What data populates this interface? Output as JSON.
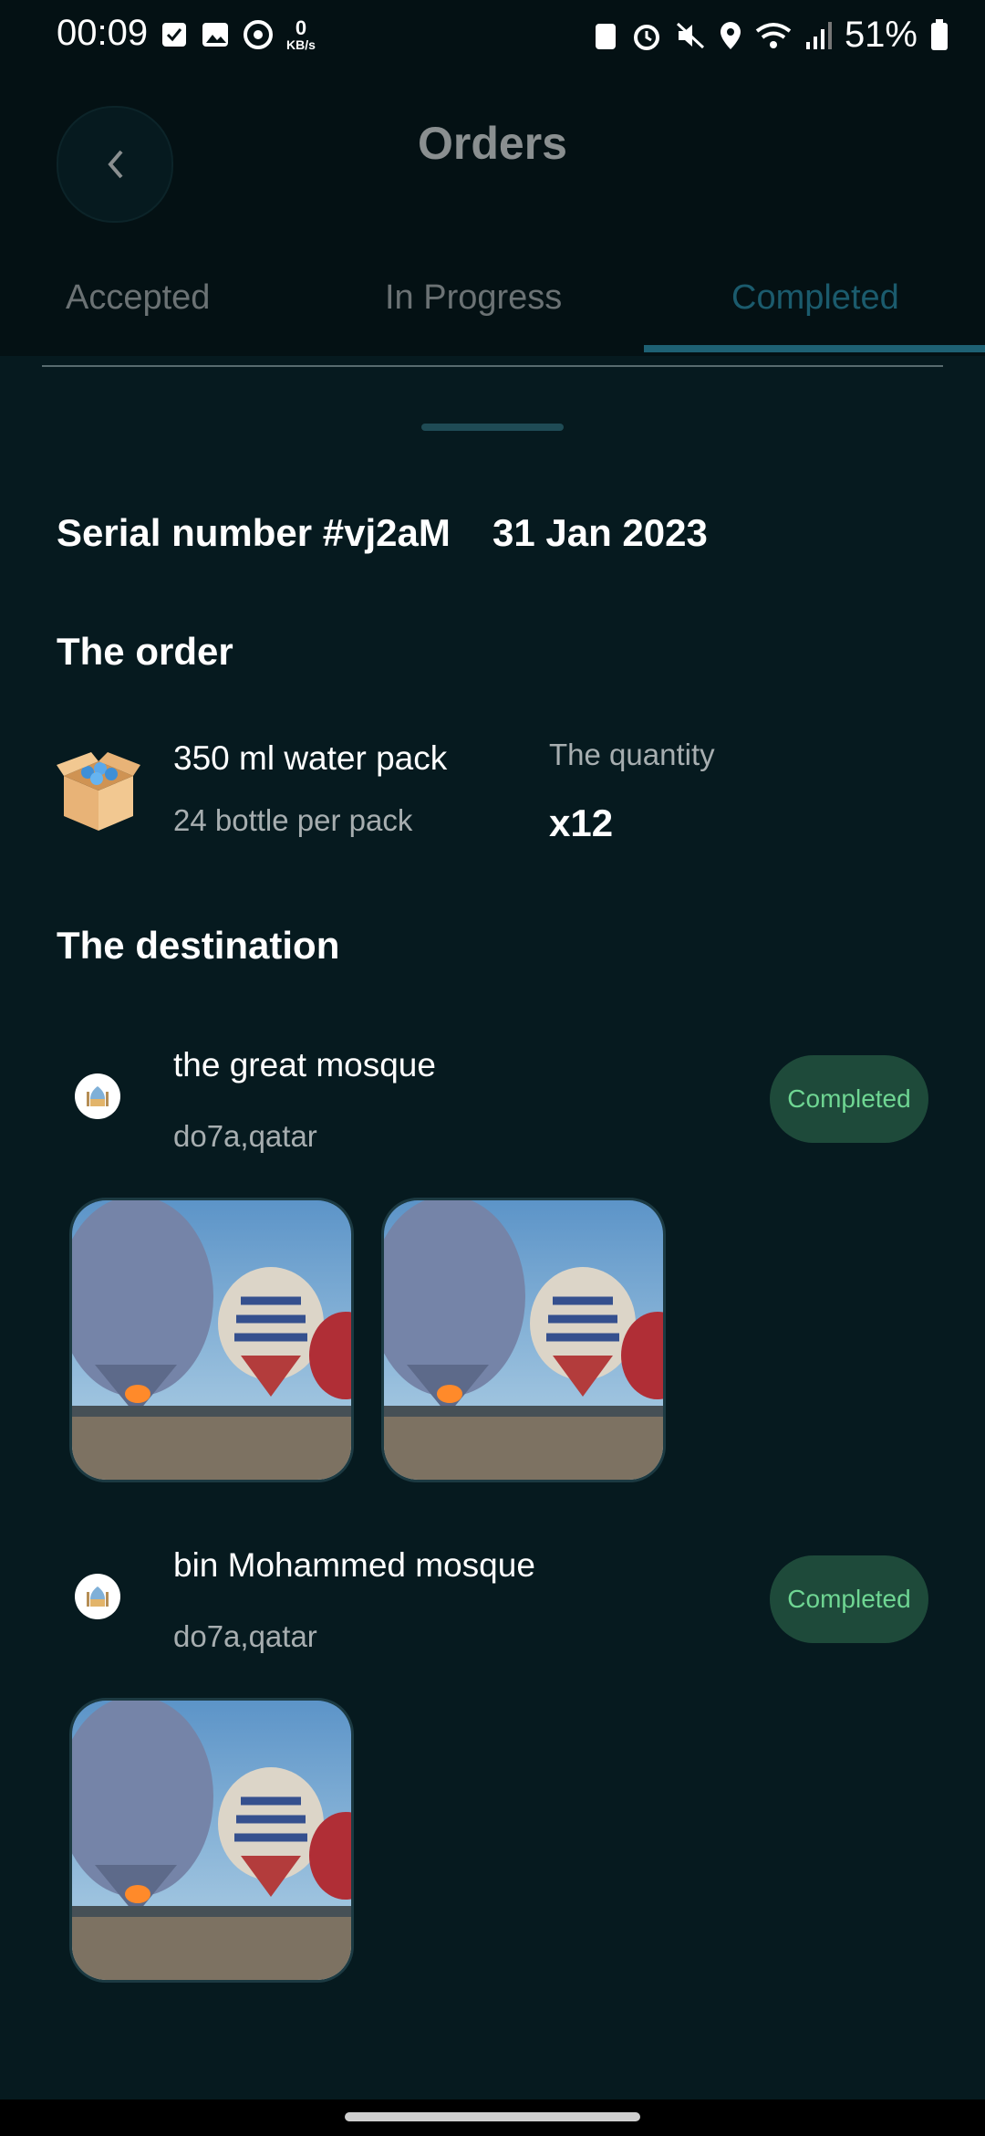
{
  "status_bar": {
    "time": "00:09",
    "net_speed_value": "0",
    "net_speed_unit": "KB/s",
    "battery": "51%"
  },
  "header": {
    "title": "Orders",
    "tabs": [
      {
        "label": "Accepted"
      },
      {
        "label": "In Progress"
      },
      {
        "label": "Completed"
      }
    ],
    "active_tab": "Completed"
  },
  "order": {
    "serial": "Serial number #vj2aM",
    "date": "31 Jan 2023",
    "section_order": "The order",
    "product_name": "350 ml water pack",
    "product_desc": "24 bottle per pack",
    "quantity_label": "The quantity",
    "quantity_value": "x12",
    "section_destination": "The destination"
  },
  "destinations": [
    {
      "name": "the great mosque",
      "location": "do7a,qatar",
      "status": "Completed",
      "photos": 2
    },
    {
      "name": "bin Mohammed mosque",
      "location": "do7a,qatar",
      "status": "Completed",
      "photos": 1
    }
  ],
  "colors": {
    "background": "#061a1f",
    "accent": "#1e6174",
    "badge_bg": "#1e4a3a",
    "badge_text": "#6fd693"
  }
}
